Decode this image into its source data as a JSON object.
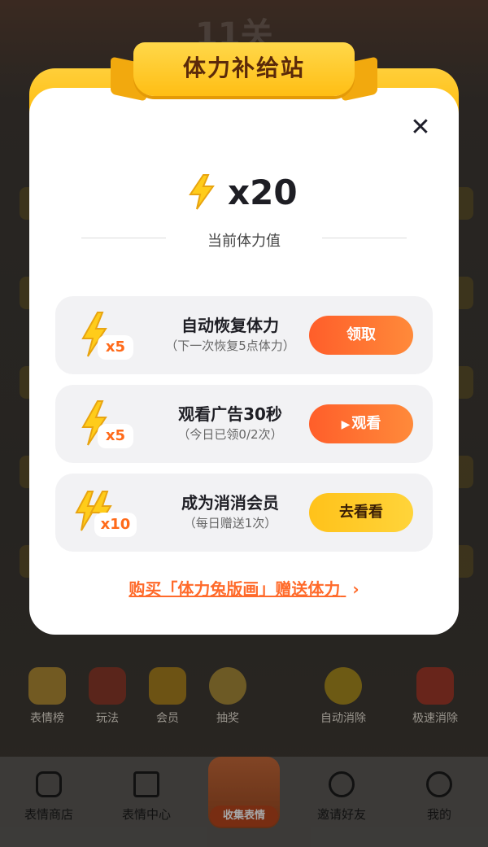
{
  "background": {
    "level": "11关",
    "quick_actions": [
      "表情榜",
      "玩法",
      "会员",
      "抽奖",
      "自动消除",
      "极速消除"
    ],
    "bottom_nav": [
      "表情商店",
      "表情中心",
      "收集表情",
      "邀请好友",
      "我的"
    ]
  },
  "modal": {
    "title": "体力补给站",
    "energy_value": "x20",
    "energy_label": "当前体力值",
    "cards": [
      {
        "multiplier": "x5",
        "title": "自动恢复体力",
        "subtitle": "（下一次恢复5点体力）",
        "button": "领取",
        "button_icon": "none"
      },
      {
        "multiplier": "x5",
        "title": "观看广告30秒",
        "subtitle": "（今日已领0/2次）",
        "button": "观看",
        "button_icon": "play-icon"
      },
      {
        "multiplier": "x10",
        "title": "成为消消会员",
        "subtitle": "（每日赠送1次）",
        "button": "去看看",
        "button_icon": "none"
      }
    ],
    "promo_link": "购买「体力兔版画」赠送体力",
    "promo_arrow": "›",
    "close_icon": "close-icon"
  },
  "colors": {
    "accent_orange": "#ff6a2a",
    "ribbon": "#ffc21a",
    "lightning": "#ffcc1a"
  }
}
